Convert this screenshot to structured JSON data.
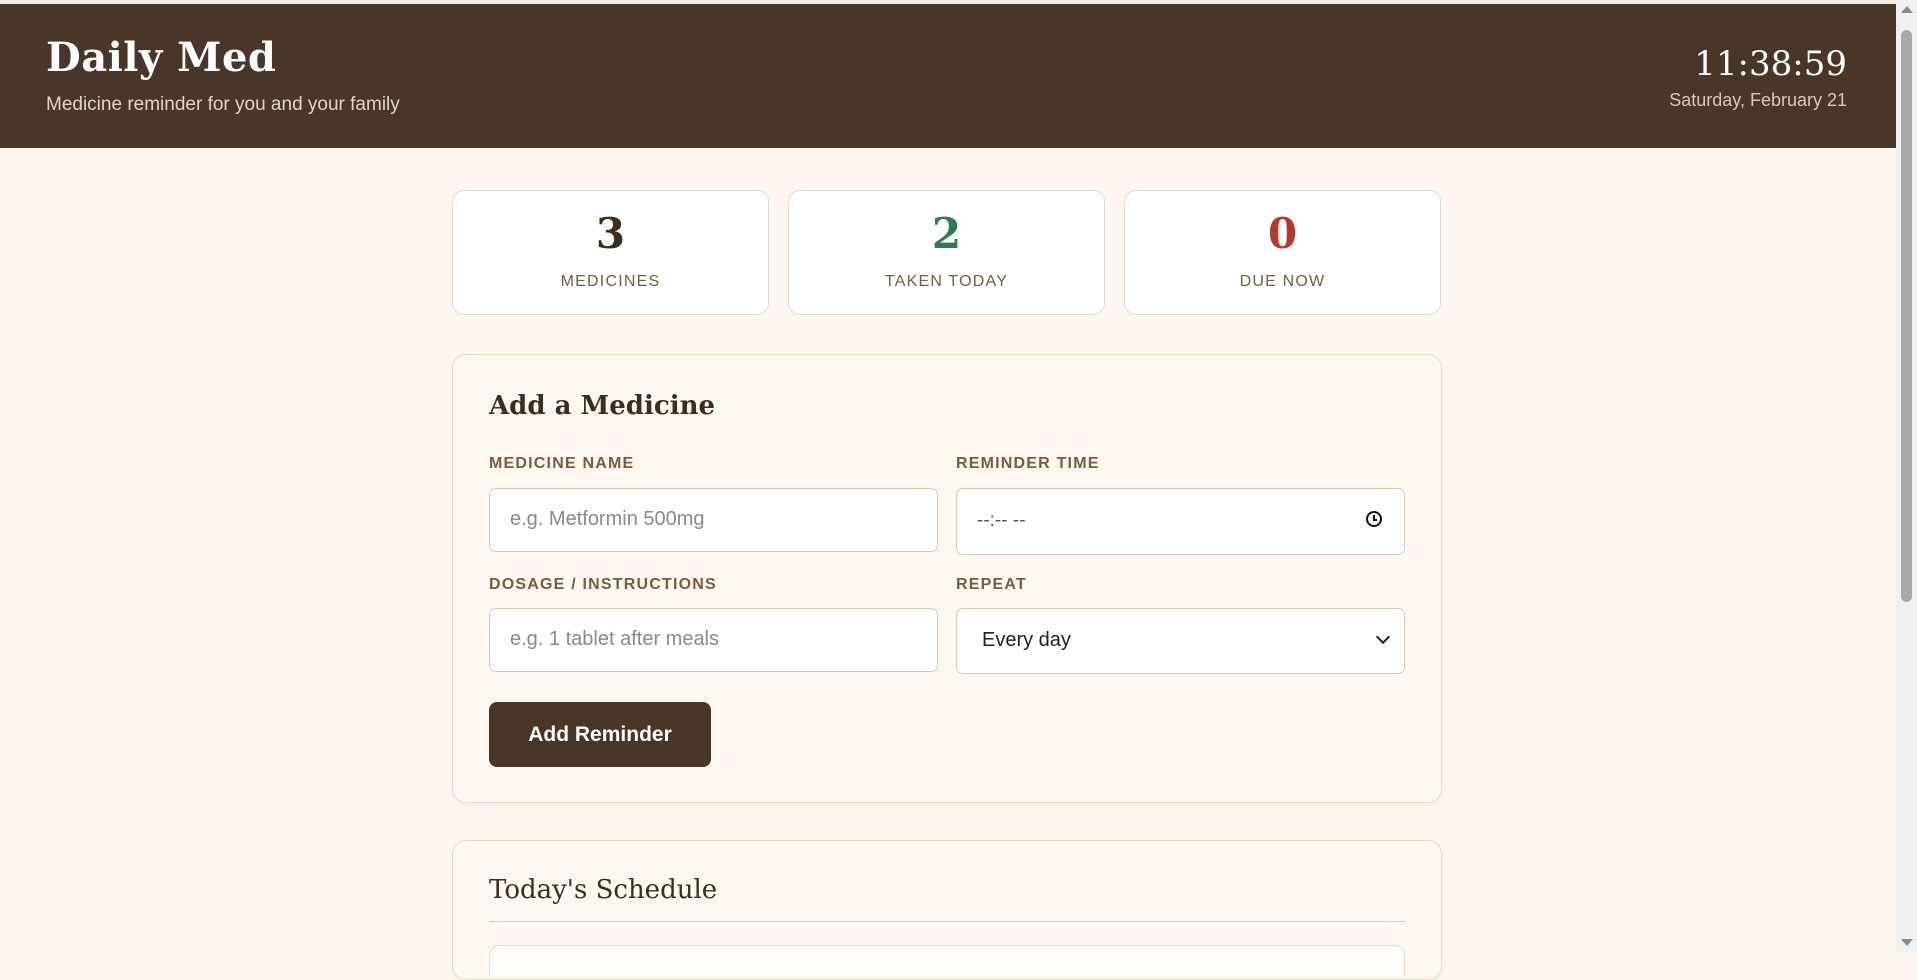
{
  "header": {
    "title": "Daily Med",
    "subtitle": "Medicine reminder for you and your family",
    "clock": "11:38:59",
    "date": "Saturday, February 21"
  },
  "stats": [
    {
      "value": "3",
      "label": "MEDICINES",
      "color": "#3e2c1e"
    },
    {
      "value": "2",
      "label": "TAKEN TODAY",
      "color": "#2e7d4f"
    },
    {
      "value": "0",
      "label": "DUE NOW",
      "color": "#b8392b"
    }
  ],
  "add_form": {
    "title": "Add a Medicine",
    "name_label": "MEDICINE NAME",
    "name_placeholder": "e.g. Metformin 500mg",
    "time_label": "REMINDER TIME",
    "time_placeholder": "--:-- --",
    "dosage_label": "DOSAGE / INSTRUCTIONS",
    "dosage_placeholder": "e.g. 1 tablet after meals",
    "repeat_label": "REPEAT",
    "repeat_value": "Every day",
    "submit_label": "Add Reminder"
  },
  "schedule": {
    "title": "Today's Schedule"
  },
  "colors": {
    "header_bg": "#4a3628",
    "page_bg": "#fdf7ef",
    "taken": "#2e7d4f",
    "due": "#b8392b"
  }
}
